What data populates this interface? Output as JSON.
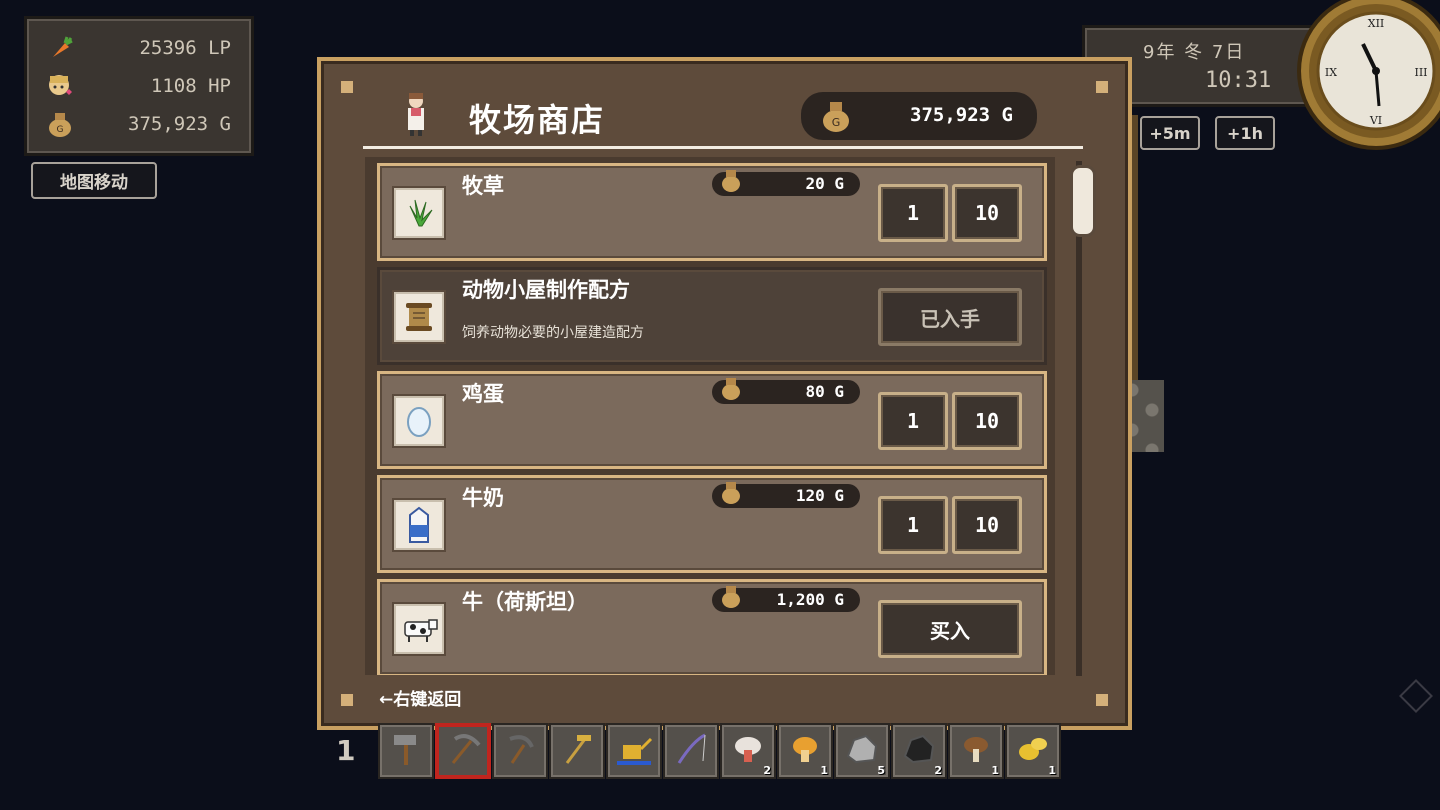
{
  "status": {
    "lp": "25396 LP",
    "hp": "1108 HP",
    "gold": "375,923 G",
    "map_button": "地图移动"
  },
  "calendar": {
    "date": "9年 冬 7日",
    "time": "10:31",
    "plus5m": "+5m",
    "plus1h": "+1h"
  },
  "shop": {
    "title": "牧场商店",
    "gold": "375,923 G",
    "back_hint": "←右键返回",
    "items": [
      {
        "name": "牧草",
        "desc": "",
        "price": "20 G",
        "buttons": [
          "1",
          "10"
        ],
        "icon": "grass-icon"
      },
      {
        "name": "动物小屋制作配方",
        "desc": "饲养动物必要的小屋建造配方",
        "price": "",
        "buttons": [
          "已入手"
        ],
        "icon": "scroll-icon"
      },
      {
        "name": "鸡蛋",
        "desc": "",
        "price": "80 G",
        "buttons": [
          "1",
          "10"
        ],
        "icon": "egg-icon"
      },
      {
        "name": "牛奶",
        "desc": "",
        "price": "120 G",
        "buttons": [
          "1",
          "10"
        ],
        "icon": "milk-icon"
      },
      {
        "name": "牛（荷斯坦）",
        "desc": "",
        "price": "1,200 G",
        "buttons": [
          "买入"
        ],
        "icon": "cow-icon"
      }
    ]
  },
  "hotbar": {
    "page": "1",
    "slots": [
      {
        "icon": "hammer-icon",
        "count": ""
      },
      {
        "icon": "pickaxe-icon",
        "count": "",
        "selected": true
      },
      {
        "icon": "sickle-icon",
        "count": ""
      },
      {
        "icon": "hoe-icon",
        "count": ""
      },
      {
        "icon": "watering-can-icon",
        "count": ""
      },
      {
        "icon": "fishing-rod-icon",
        "count": ""
      },
      {
        "icon": "white-mushroom-icon",
        "count": "2"
      },
      {
        "icon": "orange-mushroom-icon",
        "count": "1"
      },
      {
        "icon": "stone-icon",
        "count": "5"
      },
      {
        "icon": "coal-icon",
        "count": "2"
      },
      {
        "icon": "brown-mushroom-icon",
        "count": "1"
      },
      {
        "icon": "gold-ore-icon",
        "count": "1"
      }
    ]
  },
  "colors": {
    "frame_gold": "#c9a061",
    "panel_brown": "#5e4b3b",
    "selected_slot": "#c0251e"
  }
}
